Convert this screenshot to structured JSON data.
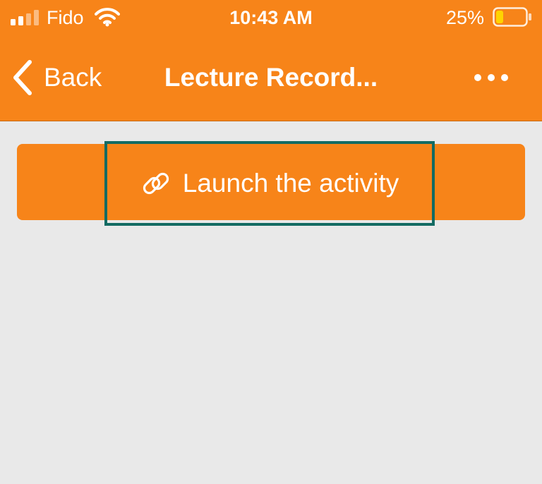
{
  "status_bar": {
    "carrier": "Fido",
    "time": "10:43 AM",
    "battery_percent": "25%",
    "battery_level": 0.25,
    "signal_bars_active": 2,
    "signal_bars_total": 4,
    "icons": [
      "signal-icon",
      "wifi-icon",
      "battery-icon"
    ]
  },
  "nav": {
    "back_label": "Back",
    "title": "Lecture Record...",
    "back_icon": "chevron-left-icon",
    "more_icon": "more-horizontal-icon"
  },
  "main": {
    "launch_button": {
      "label": "Launch the activity",
      "icon": "link-icon"
    }
  },
  "colors": {
    "accent": "#f78419",
    "background": "#e9e9e9",
    "focus_outline": "#136b63",
    "battery_fill": "#ffd400"
  }
}
